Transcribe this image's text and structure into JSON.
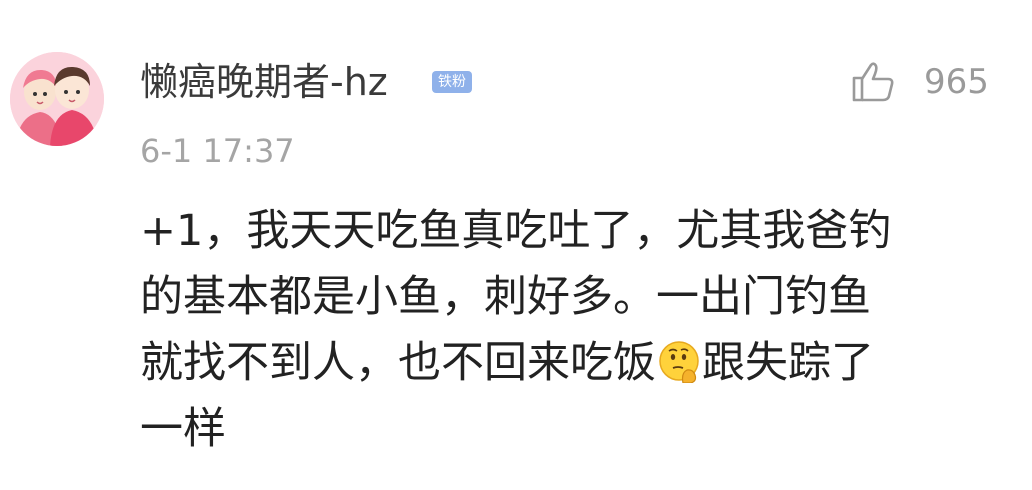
{
  "comment": {
    "username": "懒癌晚期者-hz",
    "badge": "铁粉",
    "likes": "965",
    "timestamp": "6-1 17:37",
    "content": {
      "line1": "+1，我天天吃鱼真吃吐了，尤其我爸钓",
      "line2": "的基本都是小鱼，刺好多。一出门钓鱼",
      "line3_before_emoji": "就找不到人，也不回来吃饭",
      "line3_after_emoji": "跟失踪了",
      "line4": "一样"
    },
    "icons": {
      "like": "thumbs-up-icon",
      "emoji": "thinking-face-emoji"
    },
    "colors": {
      "badge": "#8fb1ea",
      "username": "#3a3a3a",
      "meta": "#a5a5a5",
      "text": "#222222"
    }
  }
}
